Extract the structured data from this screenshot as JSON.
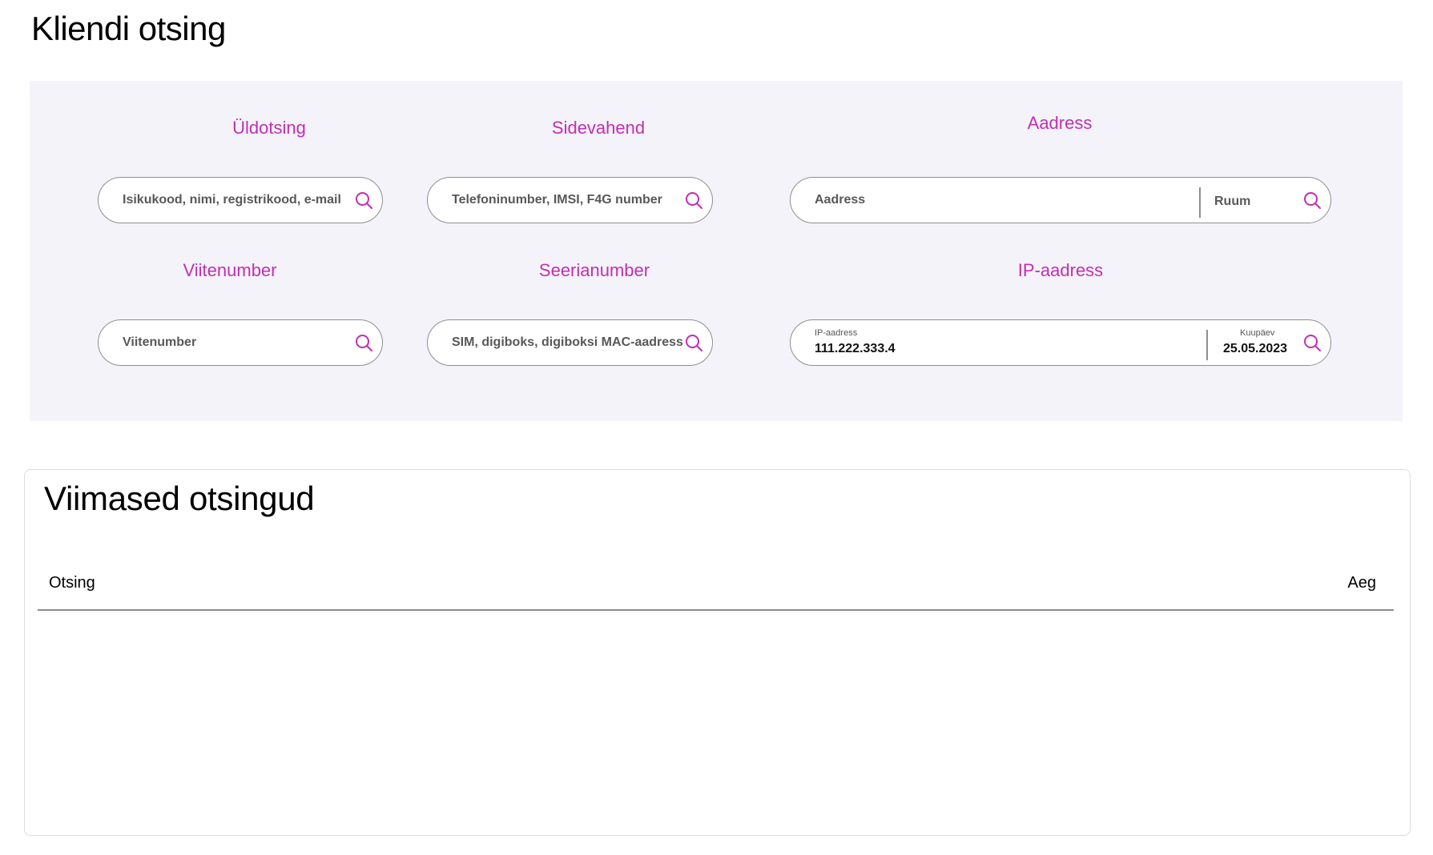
{
  "page": {
    "title": "Kliendi otsing"
  },
  "search_groups": {
    "general": {
      "title": "Üldotsing",
      "placeholder": "Isikukood, nimi, registrikood, e-mail"
    },
    "device": {
      "title": "Sidevahend",
      "placeholder": "Telefoninumber, IMSI, F4G number"
    },
    "address": {
      "title": "Aadress",
      "placeholder": "Aadress",
      "room_placeholder": "Ruum"
    },
    "reference": {
      "title": "Viitenumber",
      "placeholder": "Viitenumber"
    },
    "serial": {
      "title": "Seerianumber",
      "placeholder": "SIM, digiboks, digiboksi MAC-aadress"
    },
    "ip": {
      "title": "IP-aadress",
      "ip_label": "IP-aadress",
      "ip_value": "111.222.333.4",
      "date_label": "Kuupäev",
      "date_value": "25.05.2023"
    }
  },
  "recent": {
    "title": "Viimased otsingud",
    "columns": {
      "search": "Otsing",
      "time": "Aeg"
    },
    "rows": []
  },
  "colors": {
    "accent": "#c12fb3",
    "panel_bg": "#f4f3f9",
    "border": "#8e8e8e"
  },
  "icons": {
    "search": "search-icon"
  }
}
